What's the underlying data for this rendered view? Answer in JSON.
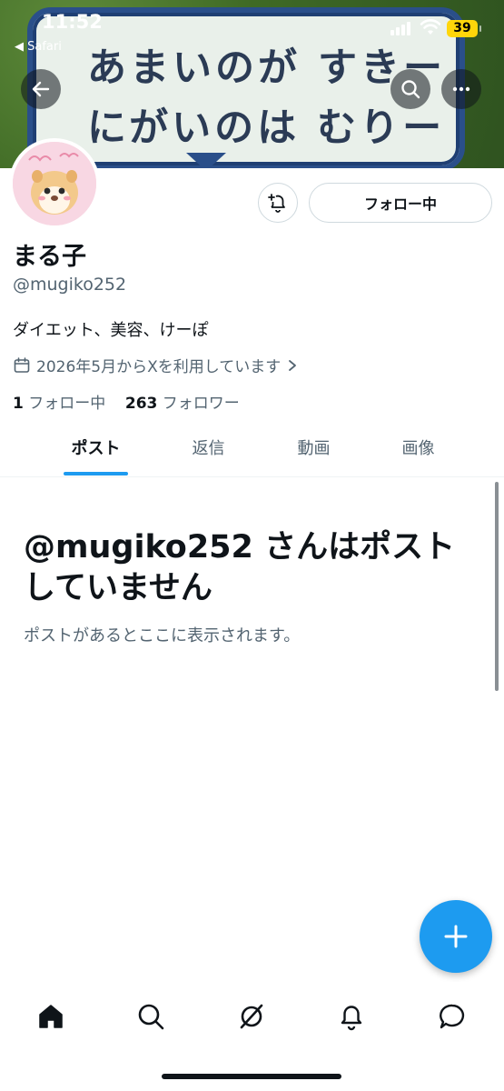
{
  "status_bar": {
    "time": "11:52",
    "back_app": "◀ Safari",
    "battery": "39"
  },
  "banner": {
    "line1": "あまいのが すきー",
    "line2": "にがいのは むりー"
  },
  "profile": {
    "name": "まる子",
    "handle": "@mugiko252",
    "bio": "ダイエット、美容、けーぽ",
    "joined": "2026年5月からXを利用しています",
    "following_count": "1",
    "following_label": "フォロー中",
    "followers_count": "263",
    "followers_label": "フォロワー"
  },
  "actions": {
    "follow_label": "フォロー中"
  },
  "tabs": [
    {
      "label": "ポスト",
      "active": true
    },
    {
      "label": "返信",
      "active": false
    },
    {
      "label": "動画",
      "active": false
    },
    {
      "label": "画像",
      "active": false
    }
  ],
  "empty_state": {
    "title": "@mugiko252 さんはポストしていません",
    "subtitle": "ポストがあるとここに表示されます。"
  },
  "icons": {
    "back": "arrow-left-icon",
    "search": "search-icon",
    "more": "more-horizontal-icon",
    "notify": "bell-plus-icon",
    "calendar": "calendar-icon",
    "fab": "plus-icon",
    "nav": [
      "home-icon",
      "search-icon",
      "grok-icon",
      "bell-icon",
      "messages-icon"
    ]
  },
  "colors": {
    "accent": "#1d9bf0",
    "text_primary": "#0f1419",
    "text_secondary": "#536471"
  }
}
